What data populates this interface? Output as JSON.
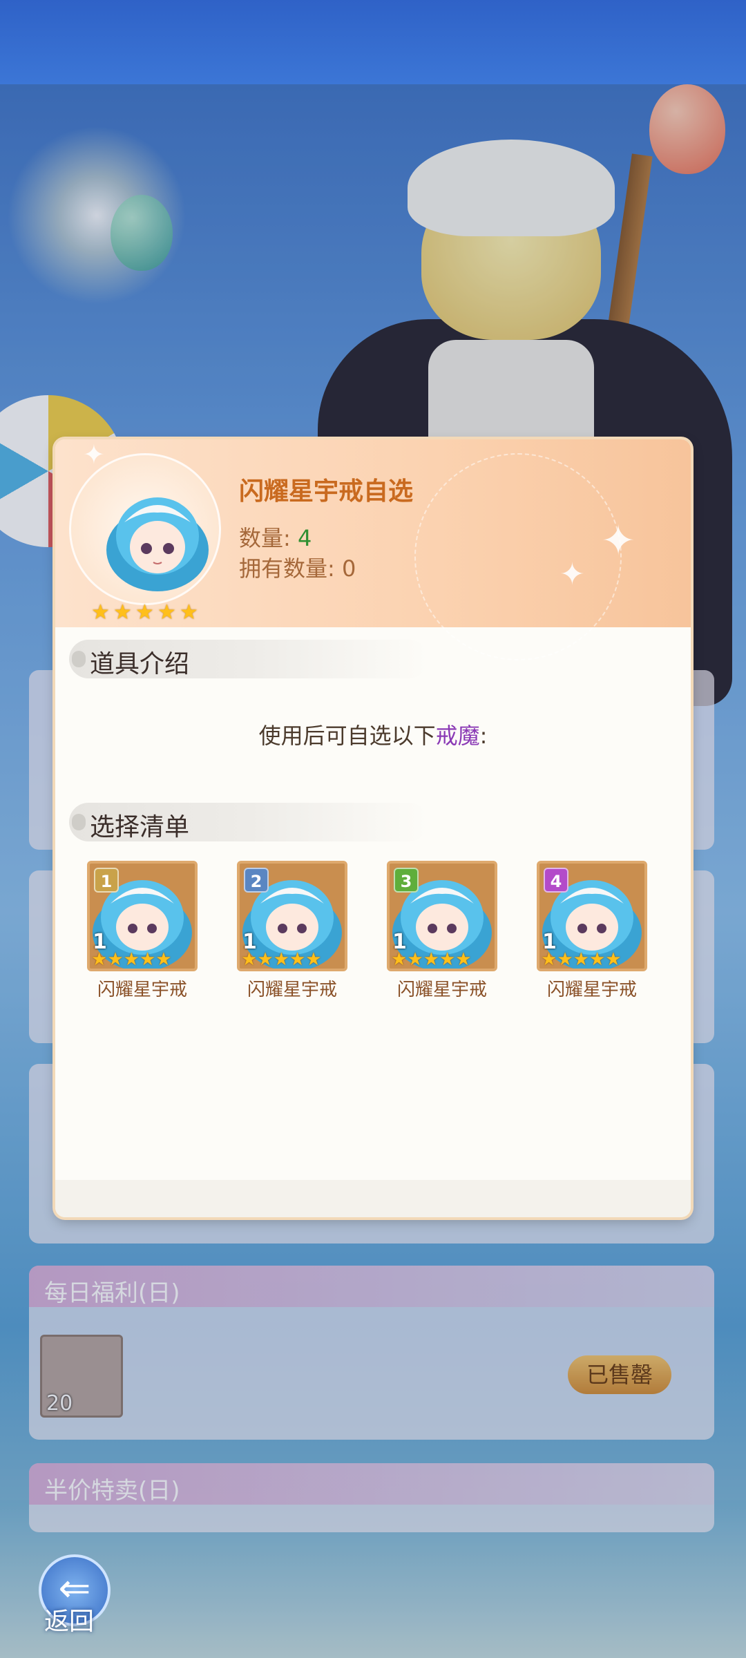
{
  "modal": {
    "title": "闪耀星宇戒自选",
    "quantity_label": "数量:",
    "quantity_value": "4",
    "owned_label": "拥有数量:",
    "owned_value": "0",
    "rarity_stars": 5,
    "section_intro": "道具介绍",
    "intro_text": "使用后可自选以下",
    "intro_highlight": "戒魔",
    "intro_suffix": ":",
    "section_choices": "选择清单",
    "choices": [
      {
        "index": "1",
        "qty": "1",
        "name": "闪耀星宇戒",
        "badge_color": "#c9a24a"
      },
      {
        "index": "2",
        "qty": "1",
        "name": "闪耀星宇戒",
        "badge_color": "#5a86c2"
      },
      {
        "index": "3",
        "qty": "1",
        "name": "闪耀星宇戒",
        "badge_color": "#5fae3b"
      },
      {
        "index": "4",
        "qty": "1",
        "name": "闪耀星宇戒",
        "badge_color": "#b34bc9"
      }
    ]
  },
  "background": {
    "daily_welfare": "每日福利(日)",
    "daily_item_count": "20",
    "sold_out": "已售罄",
    "half_price": "半价特卖(日)"
  },
  "nav": {
    "back_label": "返回",
    "back_icon": "⇐"
  }
}
